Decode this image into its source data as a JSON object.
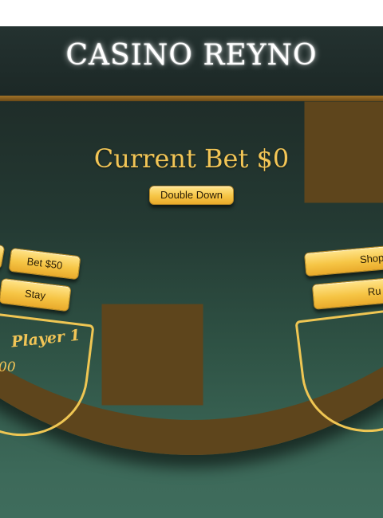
{
  "header": {
    "logo": "CASINO REYNO"
  },
  "table": {
    "current_bet": "Current Bet $0",
    "double_down": "Double Down"
  },
  "left_controls": {
    "bet_50": "Bet $50",
    "stay": "Stay"
  },
  "right_controls": {
    "shop": "Shop",
    "run": "Ru"
  },
  "player1": {
    "name": "Player 1",
    "chips": "00"
  },
  "colors": {
    "gold": "#f2c556",
    "felt": "#2f5345",
    "rail": "#5e451c"
  }
}
